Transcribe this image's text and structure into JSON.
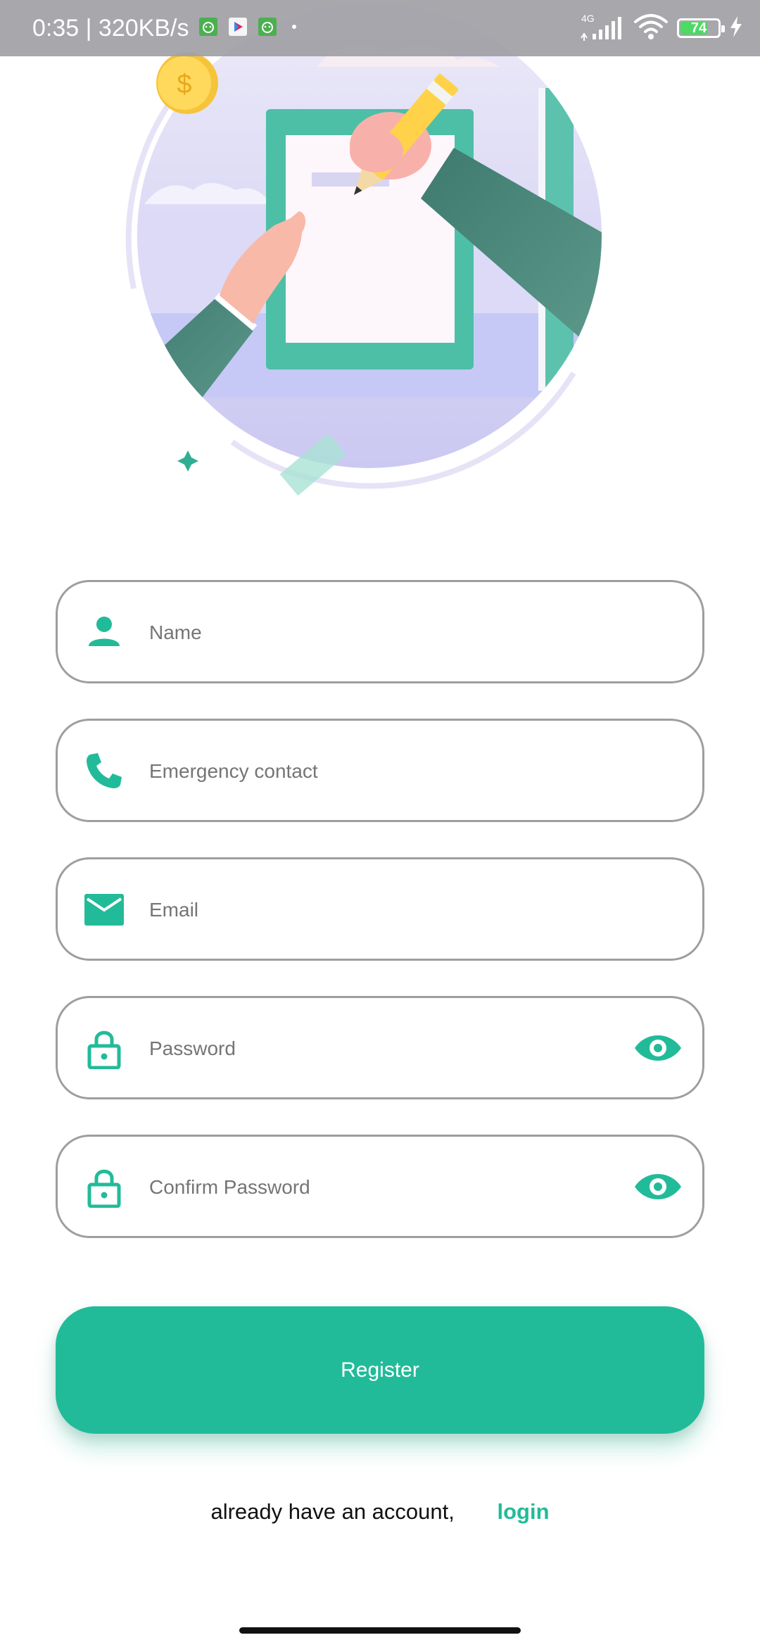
{
  "status_bar": {
    "time": "0:35",
    "speed": "320KB/s",
    "network": "4G",
    "battery": "74",
    "battery_level": 0.74
  },
  "form": {
    "name": {
      "placeholder": "Name",
      "value": "",
      "icon": "person-icon"
    },
    "emergency_contact": {
      "placeholder": "Emergency contact",
      "value": "",
      "icon": "phone-icon"
    },
    "email": {
      "placeholder": "Email",
      "value": "",
      "icon": "mail-icon"
    },
    "password": {
      "placeholder": "Password",
      "value": "",
      "icon": "lock-icon",
      "toggle_icon": "eye-icon"
    },
    "confirm_password": {
      "placeholder": "Confirm Password",
      "value": "",
      "icon": "lock-icon",
      "toggle_icon": "eye-icon"
    }
  },
  "register_label": "Register",
  "login_prompt": "already have an account,",
  "login_label": "login",
  "colors": {
    "accent": "#22bb99",
    "field_border": "#9e9e9e",
    "placeholder": "#757575"
  }
}
